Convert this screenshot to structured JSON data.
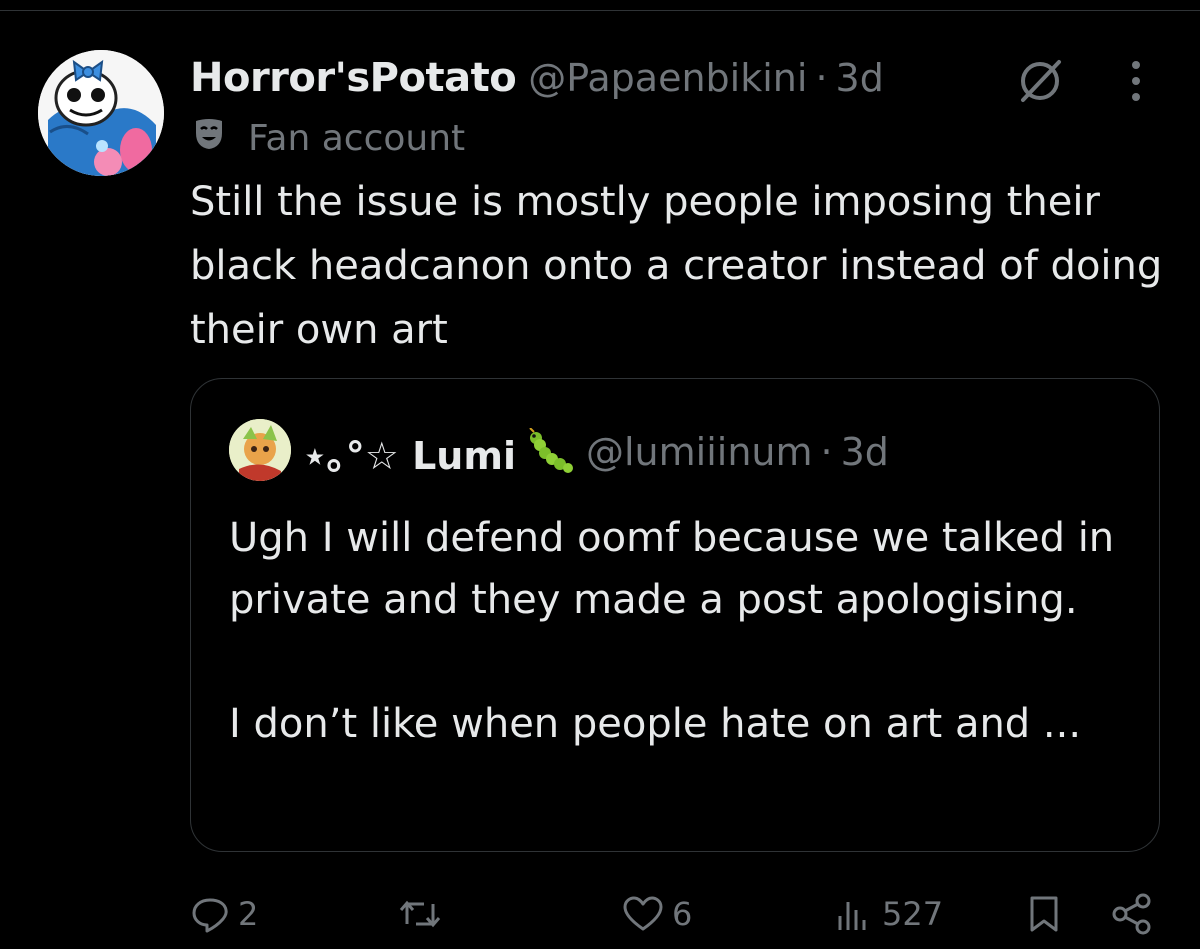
{
  "post": {
    "display_name": "Horror'sPotato",
    "handle": "@Papaenbikini",
    "separator": "·",
    "time": "3d",
    "badge_label": "Fan account",
    "text": "Still the issue is mostly people imposing their black headcanon onto a creator instead of doing their own art",
    "icons": {
      "avatar": "sans-avatar",
      "grok": "grok-icon",
      "more": "more-icon",
      "badge": "mask-icon"
    }
  },
  "quote": {
    "display_name": "⋆｡°☆ Lumi",
    "handle": "@lumiiinum",
    "separator": "·",
    "time": "3d",
    "text": "Ugh I will defend oomf because we talked in private and they made a post apologising.\n\nI don’t like when people hate on art and ...",
    "icons": {
      "avatar": "leaf-creature-avatar",
      "name_emoji": "caterpillar-emoji"
    }
  },
  "actions": {
    "replies": "2",
    "reposts": "",
    "likes": "6",
    "views": "527",
    "icons": [
      "reply-icon",
      "repost-icon",
      "like-icon",
      "views-icon",
      "bookmark-icon",
      "share-icon"
    ]
  },
  "colors": {
    "background": "#000000",
    "text": "#e7e9ea",
    "muted": "#71767b",
    "border": "#2f3336"
  }
}
